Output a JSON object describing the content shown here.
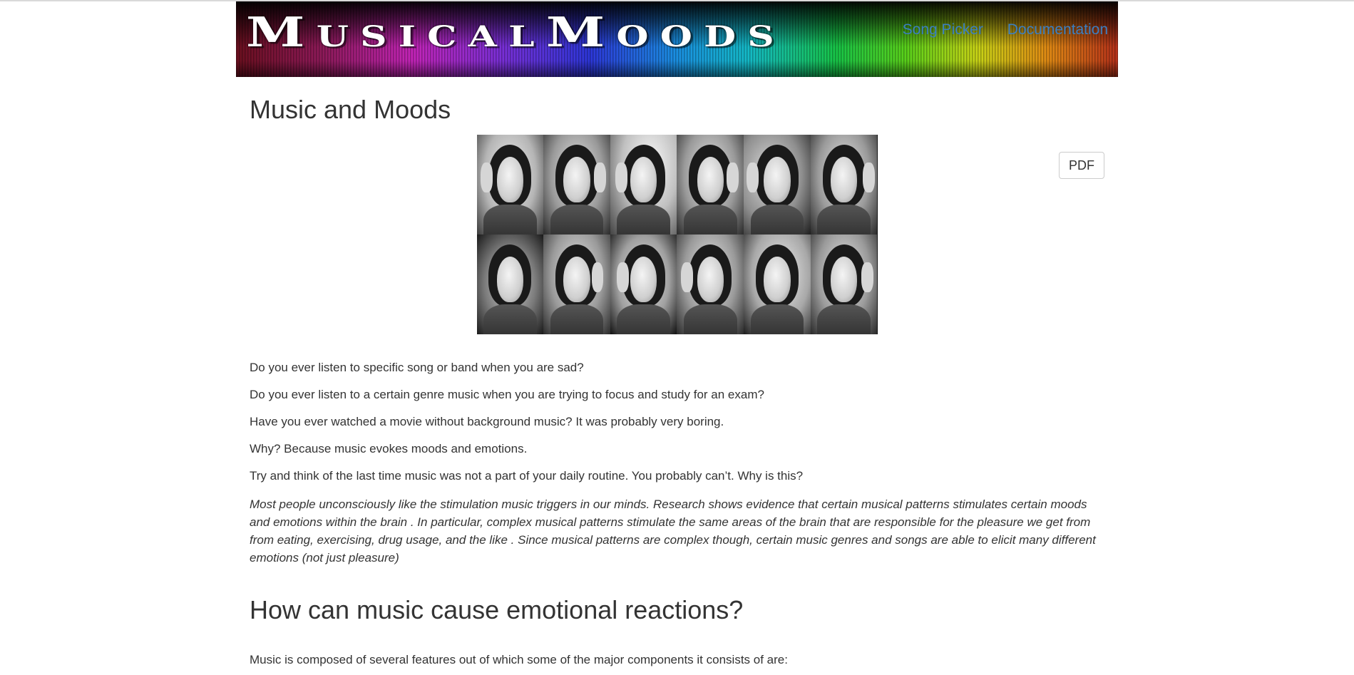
{
  "header": {
    "logo_text": "MusicalMoods",
    "nav": [
      {
        "label": "Song Picker"
      },
      {
        "label": "Documentation"
      }
    ]
  },
  "main": {
    "title": "Music and Moods",
    "pdf_button": "PDF",
    "image": {
      "description_icon": "photo-collage",
      "tiles": 12
    },
    "paragraphs": [
      "Do you ever listen to specific song or band when you are sad?",
      "Do you ever listen to a certain genre music when you are trying to focus and study for an exam?",
      "Have you ever watched a movie without background music? It was probably very boring.",
      "Why? Because music evokes moods and emotions.",
      "Try and think of the last time music was not a part of your daily routine. You probably can’t. Why is this?"
    ],
    "italic_paragraph": "Most people unconsciously like the stimulation music triggers in our minds. Research shows evidence that certain musical patterns stimulates certain moods and emotions within the brain . In particular, complex musical patterns stimulate the same areas of the brain that are responsible for the pleasure we get from from eating, exercising, drug usage, and the like . Since musical patterns are complex though, certain music genres and songs are able to elicit many different emotions (not just pleasure)",
    "section_heading": "How can music cause emotional reactions?",
    "section_intro": "Music is composed of several features out of which some of the major components it consists of are:"
  },
  "colors": {
    "link": "#3b7fc2",
    "text": "#333333",
    "background": "#ffffff"
  }
}
